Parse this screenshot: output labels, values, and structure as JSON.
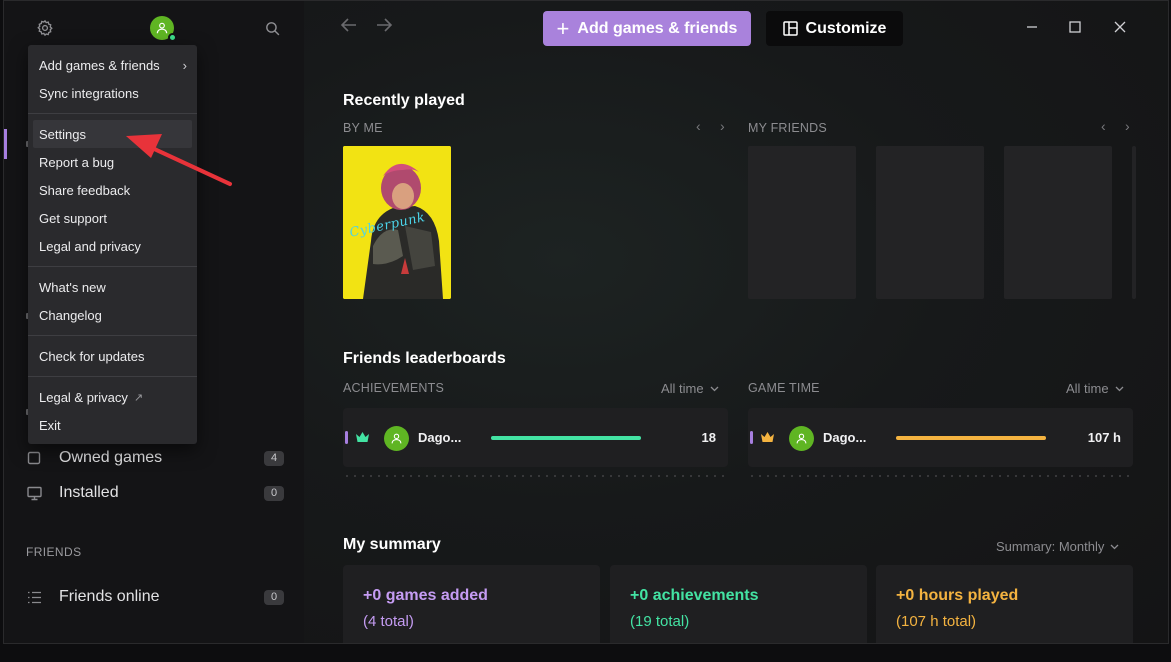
{
  "topbar": {
    "add_label": "Add games & friends",
    "customize_label": "Customize"
  },
  "menu": {
    "items": [
      {
        "label": "Add games & friends"
      },
      {
        "label": "Sync integrations"
      },
      {
        "label": "Settings"
      },
      {
        "label": "Report a bug"
      },
      {
        "label": "Share feedback"
      },
      {
        "label": "Get support"
      },
      {
        "label": "Legal and privacy"
      },
      {
        "label": "What's new"
      },
      {
        "label": "Changelog"
      },
      {
        "label": "Check for updates"
      },
      {
        "label": "Legal & privacy"
      },
      {
        "label": "Exit"
      }
    ]
  },
  "sidebar": {
    "owned_label": "Owned games",
    "owned_count": "4",
    "installed_label": "Installed",
    "installed_count": "0",
    "friends_section": "FRIENDS",
    "friends_online_label": "Friends online",
    "friends_online_count": "0"
  },
  "recent": {
    "title": "Recently played",
    "by_me": "BY ME",
    "my_friends": "MY FRIENDS",
    "cover_text": "Cyberpunk"
  },
  "leaderboards": {
    "title": "Friends leaderboards",
    "achievements": {
      "header": "ACHIEVEMENTS",
      "filter": "All time",
      "name": "Dago...",
      "value": "18",
      "progress": 1.0,
      "color": "#43e3a3"
    },
    "game_time": {
      "header": "GAME TIME",
      "filter": "All time",
      "name": "Dago...",
      "value": "107 h",
      "progress": 1.0,
      "color": "#f4b340"
    }
  },
  "summary": {
    "title": "My summary",
    "filter": "Summary: Monthly",
    "cards": [
      {
        "main": "+0 games added",
        "sub": "(4 total)",
        "color": "#c59cf3"
      },
      {
        "main": "+0 achievements",
        "sub": "(19 total)",
        "color": "#43e3a3"
      },
      {
        "main": "+0 hours played",
        "sub": "(107 h total)",
        "color": "#f4b340"
      }
    ]
  },
  "colors": {
    "accent": "#a982dc",
    "annotation_arrow": "#e8333a"
  }
}
